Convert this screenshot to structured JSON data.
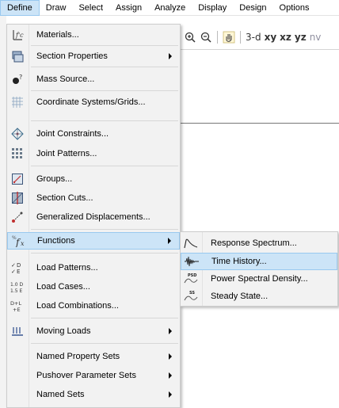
{
  "menubar": {
    "items": [
      {
        "label": "Define"
      },
      {
        "label": "Draw"
      },
      {
        "label": "Select"
      },
      {
        "label": "Assign"
      },
      {
        "label": "Analyze"
      },
      {
        "label": "Display"
      },
      {
        "label": "Design"
      },
      {
        "label": "Options"
      }
    ]
  },
  "toolbar": {
    "view_3d": "3-d",
    "view_xy": "xy",
    "view_xz": "xz",
    "view_yz": "yz",
    "view_nv": "nv"
  },
  "define_menu": {
    "items": [
      {
        "label": "Materials...",
        "icon": "materials-icon"
      },
      {
        "label": "Section Properties",
        "icon": "section-properties-icon",
        "submenu": true
      },
      {
        "label": "Mass Source...",
        "icon": "mass-source-icon"
      },
      {
        "label": "Coordinate Systems/Grids...",
        "icon": "grid-icon"
      },
      {
        "label": "Joint Constraints...",
        "icon": "joint-constraints-icon"
      },
      {
        "label": "Joint Patterns...",
        "icon": "joint-patterns-icon"
      },
      {
        "label": "Groups...",
        "icon": "groups-icon"
      },
      {
        "label": "Section Cuts...",
        "icon": "section-cuts-icon"
      },
      {
        "label": "Generalized Displacements...",
        "icon": "generalized-displacements-icon"
      },
      {
        "label": "Functions",
        "icon": "functions-icon",
        "submenu": true
      },
      {
        "label": "Load Patterns...",
        "icon": "load-patterns-icon"
      },
      {
        "label": "Load Cases...",
        "icon": "load-cases-icon"
      },
      {
        "label": "Load Combinations...",
        "icon": "load-combinations-icon"
      },
      {
        "label": "Moving Loads",
        "icon": "moving-loads-icon",
        "submenu": true
      },
      {
        "label": "Named Property Sets",
        "submenu": true
      },
      {
        "label": "Pushover Parameter Sets",
        "submenu": true
      },
      {
        "label": "Named Sets",
        "submenu": true
      }
    ],
    "icon_text": {
      "materials": "f'c",
      "functions": "f",
      "load_patterns_top": "D",
      "load_patterns_bottom": "E",
      "load_cases_top": "1.0 D",
      "load_cases_bottom": "1.5 E",
      "load_combinations_top": "D+L",
      "load_combinations_bottom": "+E"
    }
  },
  "functions_submenu": {
    "items": [
      {
        "label": "Response Spectrum...",
        "icon": "response-spectrum-icon"
      },
      {
        "label": "Time History...",
        "icon": "time-history-icon"
      },
      {
        "label": "Power Spectral Density...",
        "icon": "power-spectral-density-icon",
        "badge": "PSD"
      },
      {
        "label": "Steady State...",
        "icon": "steady-state-icon",
        "badge": "SS"
      }
    ]
  }
}
